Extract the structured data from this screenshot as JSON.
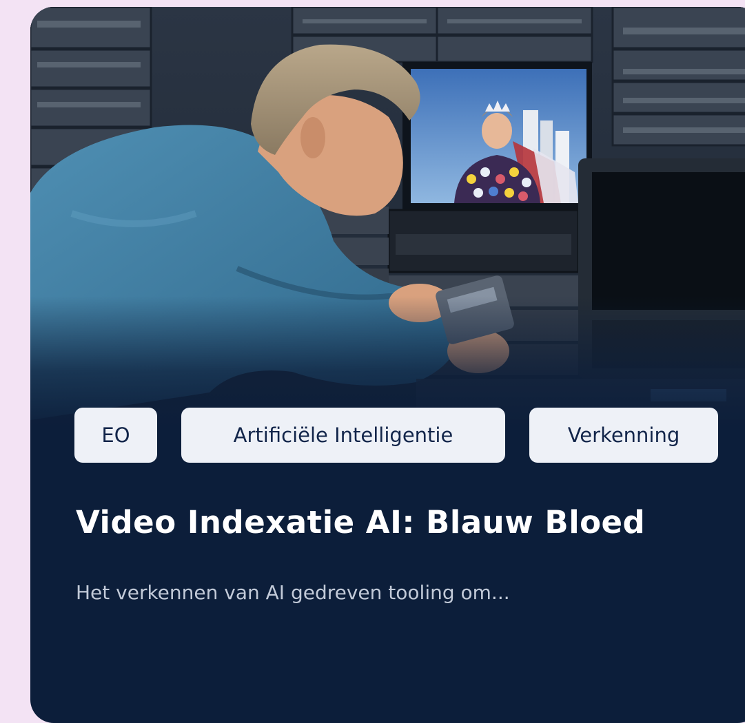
{
  "card": {
    "image_icon": "archivist-with-video-tapes-image",
    "tags": [
      "EO",
      "Artificiële Intelligentie",
      "Verkenning"
    ],
    "title": "Video Indexatie AI: Blauw Bloed",
    "description": "Het verkennen van AI gedreven tooling om..."
  },
  "colors": {
    "page_background": "#f3e3f4",
    "card_background": "#0c1e3a",
    "tag_background": "#eef1f7",
    "tag_text": "#12254a",
    "title_text": "#ffffff",
    "description_text": "#c2cad8"
  }
}
